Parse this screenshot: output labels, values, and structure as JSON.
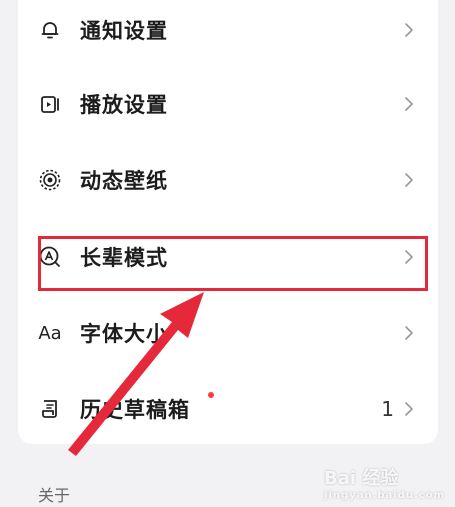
{
  "settings": {
    "items": [
      {
        "label": "通知设置",
        "icon": "bell-icon"
      },
      {
        "label": "播放设置",
        "icon": "play-settings-icon"
      },
      {
        "label": "动态壁纸",
        "icon": "live-wallpaper-icon"
      },
      {
        "label": "长辈模式",
        "icon": "elder-mode-icon"
      },
      {
        "label": "字体大小",
        "icon": "font-size-icon",
        "icon_text": "Aa"
      },
      {
        "label": "历史草稿箱",
        "icon": "drafts-icon",
        "count": "1",
        "badge_color": "#ff3b3b"
      }
    ]
  },
  "section": {
    "title": "关于"
  },
  "annotation": {
    "highlight_color": "#e5283a"
  },
  "watermark": {
    "text": "Bai 经验",
    "sub": "jingyan.baidu.com"
  }
}
